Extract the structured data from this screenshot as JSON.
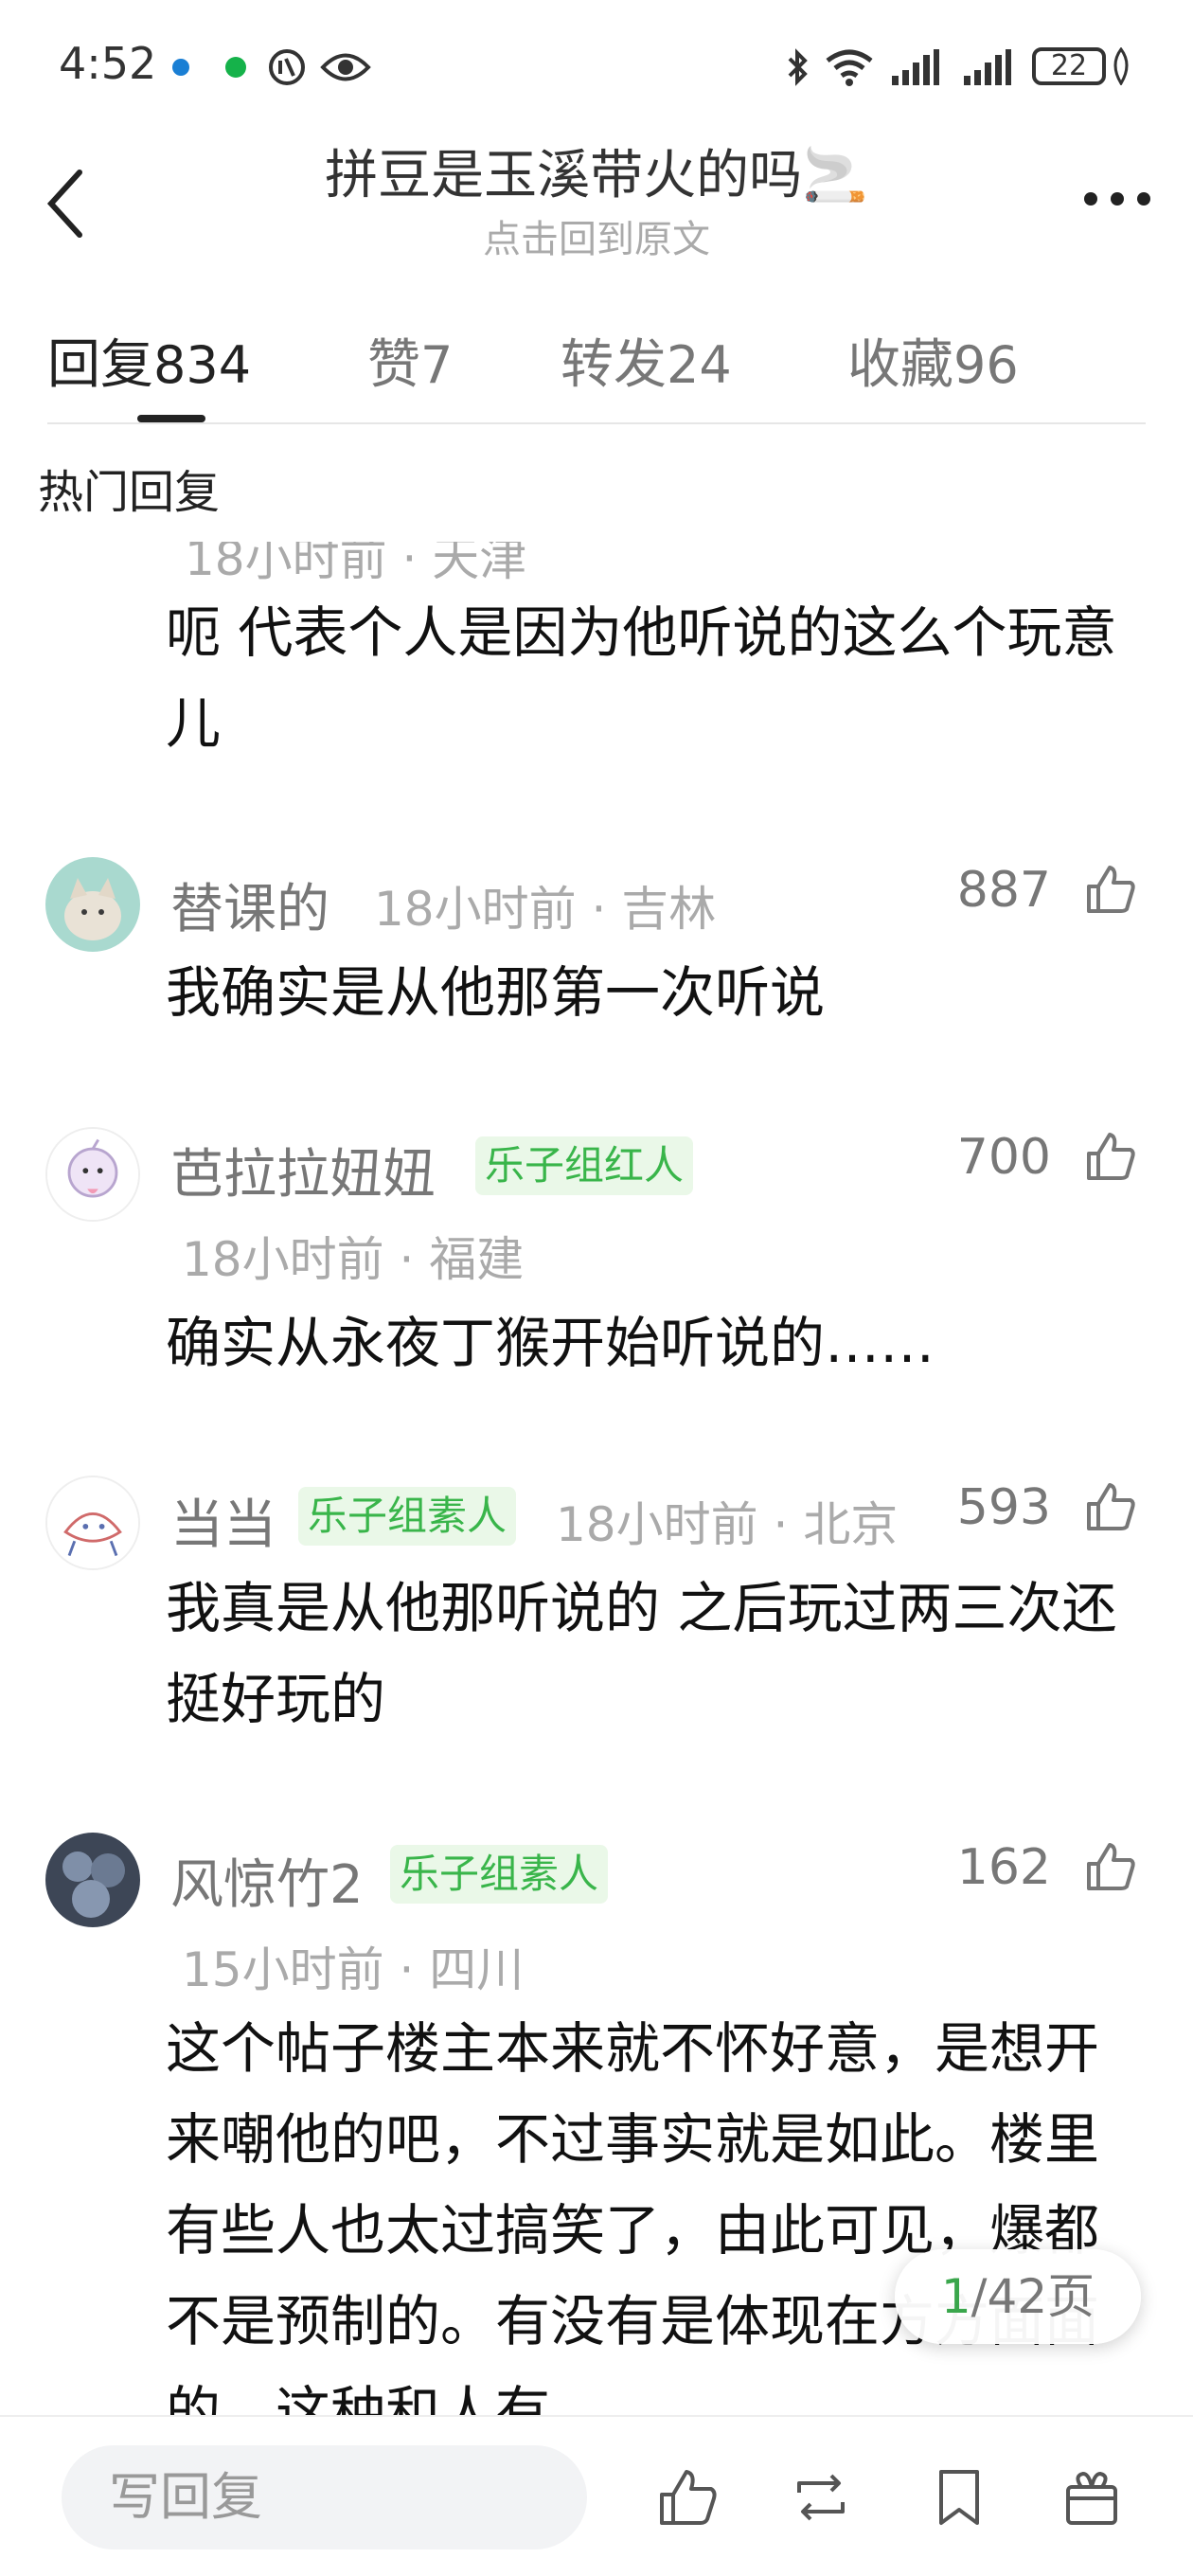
{
  "status_bar": {
    "time": "4:52",
    "battery": "22"
  },
  "header": {
    "title": "拼豆是玉溪带火的吗🚬",
    "subtitle": "点击回到原文"
  },
  "tabs": [
    {
      "label": "回复",
      "count": "834"
    },
    {
      "label": "赞",
      "count": "7"
    },
    {
      "label": "转发",
      "count": "24"
    },
    {
      "label": "收藏",
      "count": "96"
    }
  ],
  "section_label": "热门回复",
  "partial_comment": {
    "meta": "18小时前 · 天津",
    "text": "呃 代表个人是因为他听说的这么个玩意儿"
  },
  "comments": [
    {
      "user": "替课的",
      "badge": "",
      "meta": "18小时前 · 吉林",
      "likes": "887",
      "text": "我确实是从他那第一次听说"
    },
    {
      "user": "芭拉拉妞妞",
      "badge": "乐子组红人",
      "meta": "18小时前 · 福建",
      "likes": "700",
      "text": "确实从永夜丁猴开始听说的……"
    },
    {
      "user": "当当",
      "badge": "乐子组素人",
      "meta": "18小时前 · 北京",
      "likes": "593",
      "text": "我真是从他那听说的 之后玩过两三次还挺好玩的"
    },
    {
      "user": "风惊竹2",
      "badge": "乐子组素人",
      "meta": "15小时前 · 四川",
      "likes": "162",
      "text": "这个帖子楼主本来就不怀好意，是想开来嘲他的吧，不过事实就是如此。楼里有些人也太过搞笑了，由此可见，爆都不是预制的。有没有是体现在方方面面的，这种和人有"
    }
  ],
  "pagination": {
    "current": "1",
    "total": "/42页"
  },
  "bottom_bar": {
    "reply_placeholder": "写回复"
  },
  "colors": {
    "accent_green": "#39b54a",
    "badge_bg": "#eaf8e8"
  }
}
